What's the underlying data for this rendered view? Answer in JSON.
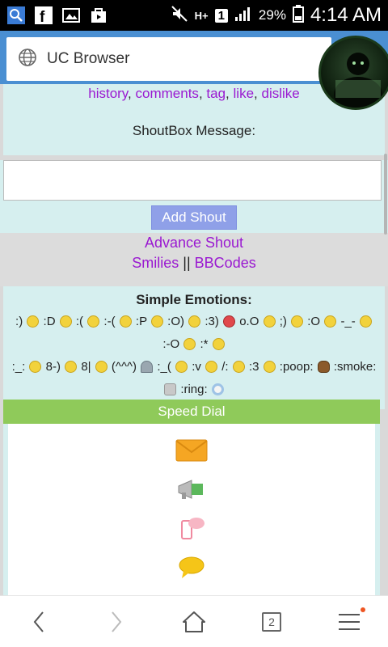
{
  "status_bar": {
    "battery": "29%",
    "time": "4:14 AM",
    "sim_badge": "1",
    "network_label": "H+"
  },
  "browser": {
    "title": "UC Browser"
  },
  "top_links": {
    "history": "history",
    "comments": "comments",
    "tag": "tag",
    "like": "like",
    "dislike": "dislike",
    "separator": ","
  },
  "shoutbox": {
    "label": "ShoutBox Message:",
    "input_value": "",
    "add_button": "Add Shout"
  },
  "extras": {
    "advance_shout": "Advance Shout",
    "smilies": "Smilies",
    "separator": "||",
    "bbcodes": "BBCodes"
  },
  "emotions": {
    "heading": "Simple Emotions:",
    "row1": [
      ":)",
      ":D",
      ":(",
      ":-(",
      ":P",
      ":O)",
      ":3)",
      "o.O",
      ";)",
      ":O",
      "-_-"
    ],
    "row2": [
      ":-O",
      ":*"
    ],
    "row3": [
      ":_:",
      "8-)",
      "8|",
      "(^^^)",
      ":_(",
      ":v",
      "/:",
      ":3",
      ":poop:",
      ":smoke:"
    ],
    "row4": [
      ":ring:"
    ]
  },
  "speed_dial": {
    "title": "Speed Dial"
  },
  "nav": {
    "tab_count": "2"
  },
  "colors": {
    "link": "#9a19d1",
    "panel": "#d6efef",
    "speed_header": "#8fca5a",
    "button": "#8fa0e8",
    "url_bar_bg": "#4a8fd2"
  }
}
